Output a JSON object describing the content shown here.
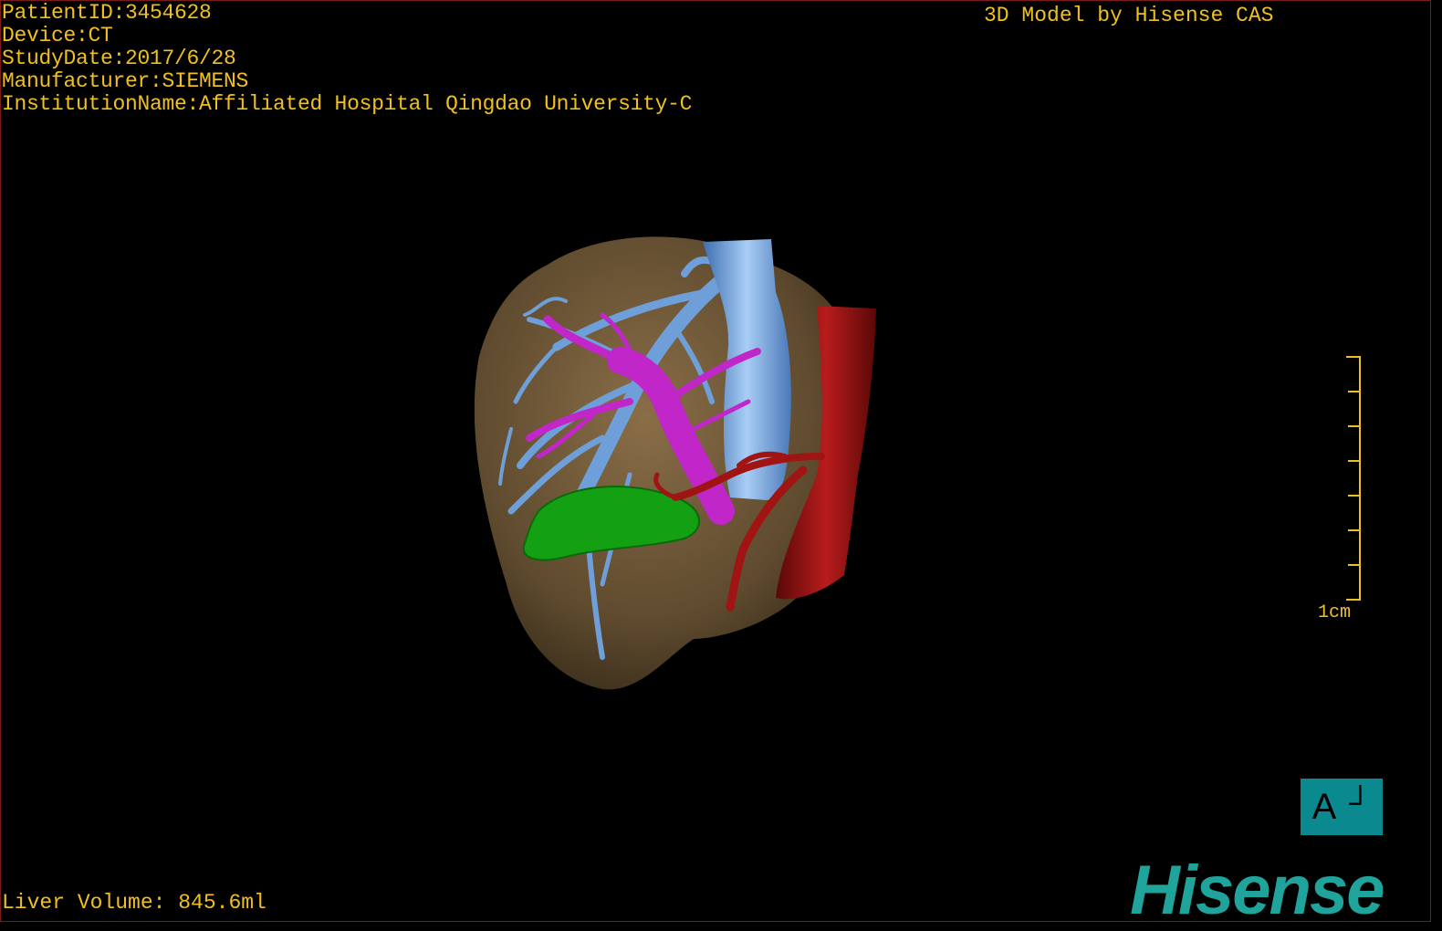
{
  "header": {
    "patient_id": "PatientID:3454628",
    "device": "Device:CT",
    "study_date": "StudyDate:2017/6/28",
    "manufacturer": "Manufacturer:SIEMENS",
    "institution": "InstitutionName:Affiliated Hospital Qingdao University-C"
  },
  "title": "3D Model by Hisense CAS",
  "footer": {
    "liver_volume": "Liver Volume: 845.6ml"
  },
  "scale_bar": {
    "label": "1cm"
  },
  "orientation": {
    "letter": "A",
    "mark": "┘"
  },
  "logo": "Hisense",
  "colors": {
    "text": "#f0c020",
    "liver": "#6b5535",
    "hepatic_vein": "#6e9fd8",
    "portal_vein": "#c026c8",
    "aorta": "#9a1010",
    "gallbladder": "#13a013",
    "orientation_box": "#0a8a8e",
    "logo": "#1fa39a"
  },
  "icons": {
    "orientation": "orientation-cube-icon",
    "logo": "hisense-logo"
  }
}
